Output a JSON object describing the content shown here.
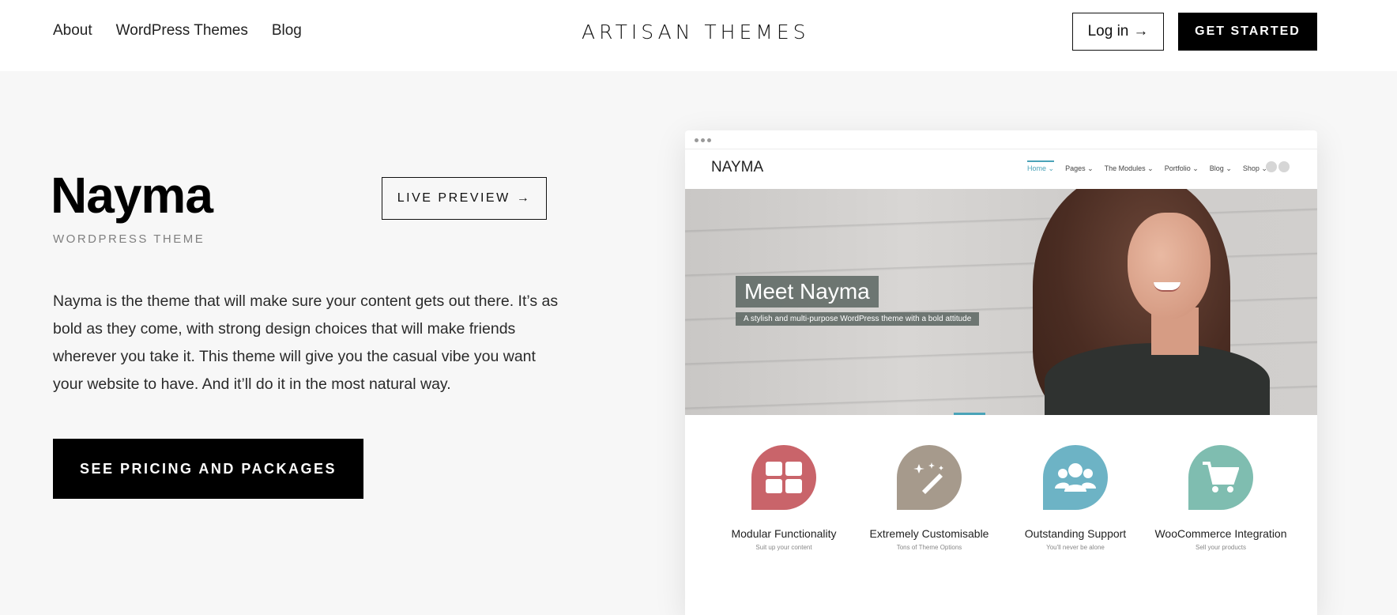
{
  "header": {
    "nav": [
      "About",
      "WordPress Themes",
      "Blog"
    ],
    "logo": "ARTISAN THEMES",
    "login_label": "Log in",
    "get_started_label": "GET STARTED"
  },
  "hero": {
    "title": "Nayma",
    "subtitle": "WORDPRESS THEME",
    "live_preview_label": "LIVE PREVIEW",
    "description": "Nayma is the theme that will make sure your content gets out there. It’s as bold as they come, with strong design choices that will make friends wherever you take it. This theme will give you the casual vibe you want your website to have. And it’ll do it in the most natural way.",
    "pricing_label": "SEE PRICING AND PACKAGES"
  },
  "mock": {
    "logo": "NAYMA",
    "menu": [
      "Home",
      "Pages",
      "The Modules",
      "Portfolio",
      "Blog",
      "Shop"
    ],
    "hero_title": "Meet Nayma",
    "hero_tagline": "A stylish and multi-purpose WordPress theme with a bold attitude",
    "features": [
      {
        "title": "Modular Functionality",
        "sub": "Suit up your content",
        "color": "#c9646a",
        "icon": "grid-icon"
      },
      {
        "title": "Extremely Customisable",
        "sub": "Tons of Theme Options",
        "color": "#a69a8c",
        "icon": "magic-wand-icon"
      },
      {
        "title": "Outstanding Support",
        "sub": "You'll never be alone",
        "color": "#6db3c5",
        "icon": "users-icon"
      },
      {
        "title": "WooCommerce Integration",
        "sub": "Sell your products",
        "color": "#7fbdb0",
        "icon": "cart-icon"
      }
    ]
  },
  "colors": {
    "accent": "#4aa3b8",
    "background": "#f7f7f7",
    "button": "#000000"
  }
}
